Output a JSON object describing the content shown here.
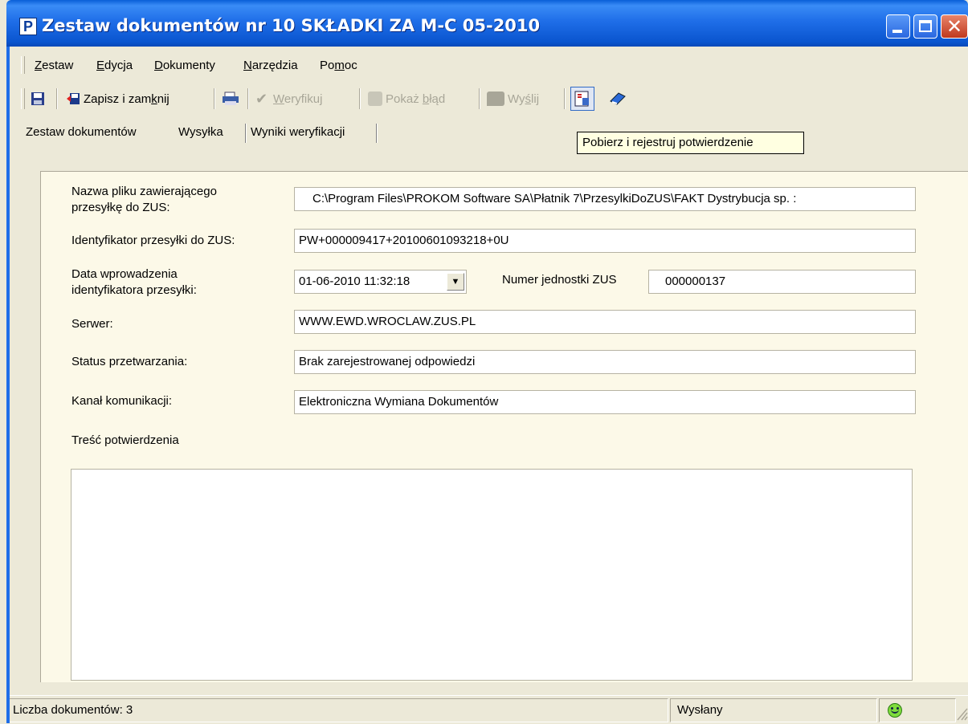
{
  "window": {
    "title": "Zestaw dokumentów nr 10 SKŁADKI ZA M-C 05-2010",
    "app_icon_letter": "P",
    "close_glyph": "✕"
  },
  "menu": {
    "items": [
      {
        "pre": "",
        "ul": "Z",
        "post": "estaw"
      },
      {
        "pre": "",
        "ul": "E",
        "post": "dycja"
      },
      {
        "pre": "",
        "ul": "D",
        "post": "okumenty"
      },
      {
        "pre": "",
        "ul": "N",
        "post": "arzędzia"
      },
      {
        "pre": "Po",
        "ul": "m",
        "post": "oc"
      }
    ]
  },
  "toolbar": {
    "save_close_pre": "Zapisz i zam",
    "save_close_ul": "k",
    "save_close_post": "nij",
    "verify_ul": "W",
    "verify_post": "eryfikuj",
    "show_error_pre": "Pokaż ",
    "show_error_ul": "b",
    "show_error_post": "łąd",
    "send_pre": "Wy",
    "send_ul": "ś",
    "send_post": "lij"
  },
  "tabs": [
    "Zestaw dokumentów",
    "Wysyłka",
    "Wyniki weryfikacji"
  ],
  "tooltip": "Pobierz i rejestruj potwierdzenie",
  "form": {
    "file_label_1": "Nazwa pliku zawierającego",
    "file_label_2": "przesyłkę do ZUS:",
    "file_value": "C:\\Program Files\\PROKOM Software SA\\Płatnik 7\\PrzesylkiDoZUS\\FAKT Dystrybucja sp. :",
    "id_label": "Identyfikator przesyłki do ZUS:",
    "id_value": "PW+000009417+20100601093218+0U",
    "date_label_1": "Data wprowadzenia",
    "date_label_2": "identyfikatora przesyłki:",
    "date_value": "01-06-2010 11:32:18",
    "unit_label": "Numer jednostki ZUS",
    "unit_value": "000000137",
    "server_label": "Serwer:",
    "server_value": "WWW.EWD.WROCLAW.ZUS.PL",
    "status_label": "Status przetwarzania:",
    "status_value": "Brak zarejestrowanej odpowiedzi",
    "channel_label": "Kanał komunikacji:",
    "channel_value": "Elektroniczna Wymiana Dokumentów",
    "confirmation_label": "Treść potwierdzenia",
    "confirmation_value": ""
  },
  "statusbar": {
    "doc_count": "Liczba dokumentów: 3",
    "state": "Wysłany"
  },
  "colors": {
    "titlebar": "#0a5fd8",
    "panel": "#fcf9e8",
    "tooltip": "#ffffe1"
  }
}
